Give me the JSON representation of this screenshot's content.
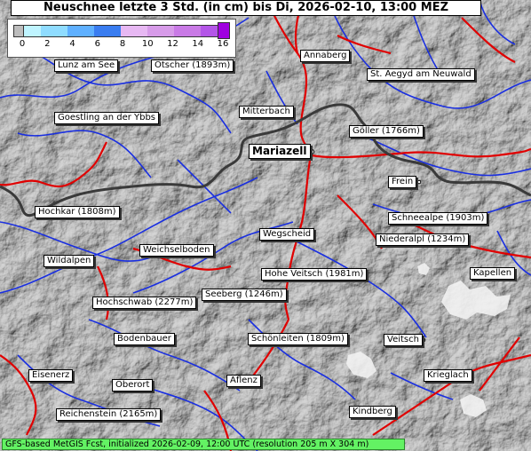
{
  "title": "Neuschnee letzte 3 Std. (in cm) bis Di, 2026-02-10, 13:00 MEZ",
  "legend": {
    "ticks": [
      "0",
      "2",
      "4",
      "6",
      "8",
      "10",
      "12",
      "14",
      "16"
    ],
    "colors": [
      "#bff4ff",
      "#8fdcff",
      "#5fb0ff",
      "#3a7df0",
      "#e7b8f3",
      "#d79be9",
      "#c97ae6",
      "#b456e8"
    ]
  },
  "places": {
    "lunz": "Lunz am See",
    "oetscher": "Ötscher (1893m)",
    "annaberg": "Annaberg",
    "st_aegyd": "St. Aegyd am Neuwald",
    "goestling": "Goestling an der Ybbs",
    "mitterbach": "Mitterbach",
    "goeller": "Göller (1766m)",
    "mariazell": "Mariazell",
    "frein": "Frein",
    "hochkar": "Hochkar (1808m)",
    "schneealpe": "Schneealpe (1903m)",
    "wegscheid": "Wegscheid",
    "niederalpl": "Niederalpl (1234m)",
    "weichselboden": "Weichselboden",
    "wildalpen": "Wildalpen",
    "hohe_veitsch": "Hohe Veitsch (1981m)",
    "kapellen": "Kapellen",
    "seeberg": "Seeberg (1246m)",
    "hochschwab": "Hochschwab (2277m)",
    "bodenbauer": "Bodenbauer",
    "schoenleiten": "Schönleiten (1809m)",
    "veitsch": "Veitsch",
    "eisenerz": "Eisenerz",
    "oberort": "Oberort",
    "aflenz": "Aflenz",
    "krieglach": "Krieglach",
    "reichenstein": "Reichenstein (2165m)",
    "kindberg": "Kindberg"
  },
  "footer": "GFS-based MetGIS Fcst, initialized 2026-02-09, 12:00 UTC  (resolution 205 m X 304 m)"
}
